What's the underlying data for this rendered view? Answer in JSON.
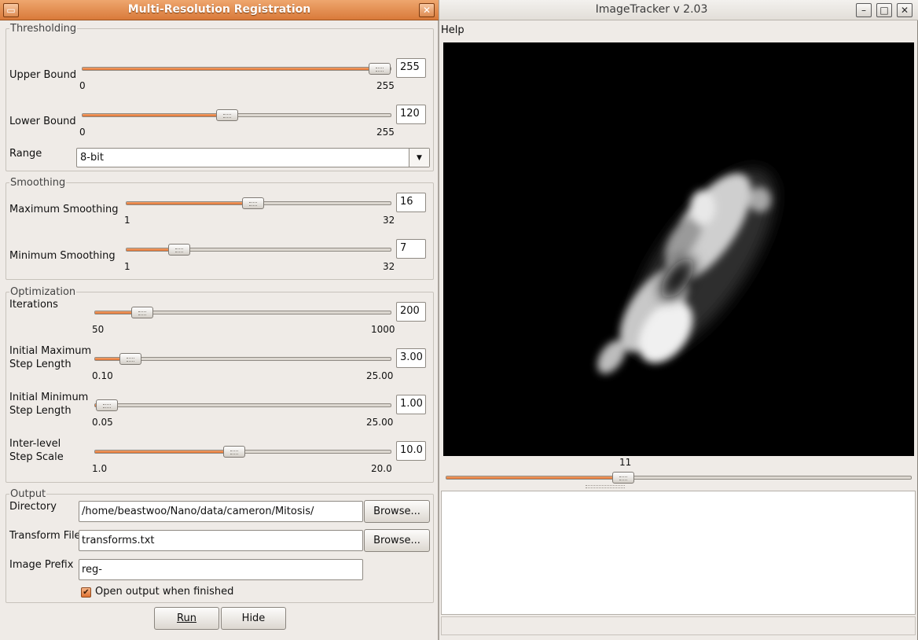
{
  "dialog": {
    "title": "Multi-Resolution Registration",
    "thresholding": {
      "label": "Thresholding",
      "upper": {
        "label": "Upper Bound",
        "min": "0",
        "max": "255",
        "value": "255",
        "fraction": 1.0
      },
      "lower": {
        "label": "Lower Bound",
        "min": "0",
        "max": "255",
        "value": "120",
        "fraction": 0.47
      },
      "range": {
        "label": "Range",
        "value": "8-bit"
      }
    },
    "smoothing": {
      "label": "Smoothing",
      "max": {
        "label": "Maximum Smoothing",
        "min": "1",
        "max": "32",
        "value": "16",
        "fraction": 0.48
      },
      "min": {
        "label": "Minimum Smoothing",
        "min": "1",
        "max": "32",
        "value": "7",
        "fraction": 0.2
      }
    },
    "optimization": {
      "label": "Optimization",
      "iterations": {
        "label": "Iterations",
        "min": "50",
        "max": "1000",
        "value": "200",
        "fraction": 0.16
      },
      "max_step": {
        "label_line1": "Initial Maximum",
        "label_line2": "Step Length",
        "min": "0.10",
        "max": "25.00",
        "value": "3.00",
        "fraction": 0.12
      },
      "min_step": {
        "label_line1": "Initial Minimum",
        "label_line2": "Step Length",
        "min": "0.05",
        "max": "25.00",
        "value": "1.00",
        "fraction": 0.04
      },
      "step_scale": {
        "label_line1": "Inter-level",
        "label_line2": "Step Scale",
        "min": "1.0",
        "max": "20.0",
        "value": "10.0",
        "fraction": 0.47
      }
    },
    "output": {
      "label": "Output",
      "directory": {
        "label": "Directory",
        "value": "/home/beastwoo/Nano/data/cameron/Mitosis/",
        "browse": "Browse..."
      },
      "transform": {
        "label": "Transform File",
        "value": "transforms.txt",
        "browse": "Browse..."
      },
      "prefix": {
        "label": "Image Prefix",
        "value": "reg-"
      },
      "open_output": {
        "label": "Open output when finished",
        "checked": true
      }
    },
    "buttons": {
      "run": "Run",
      "hide": "Hide"
    }
  },
  "main_window": {
    "title": "ImageTracker v 2.03",
    "menu": {
      "help": "Help"
    },
    "frame_slider": {
      "value": "11",
      "fraction": 0.38
    },
    "log_text": "",
    "status_text": ""
  }
}
